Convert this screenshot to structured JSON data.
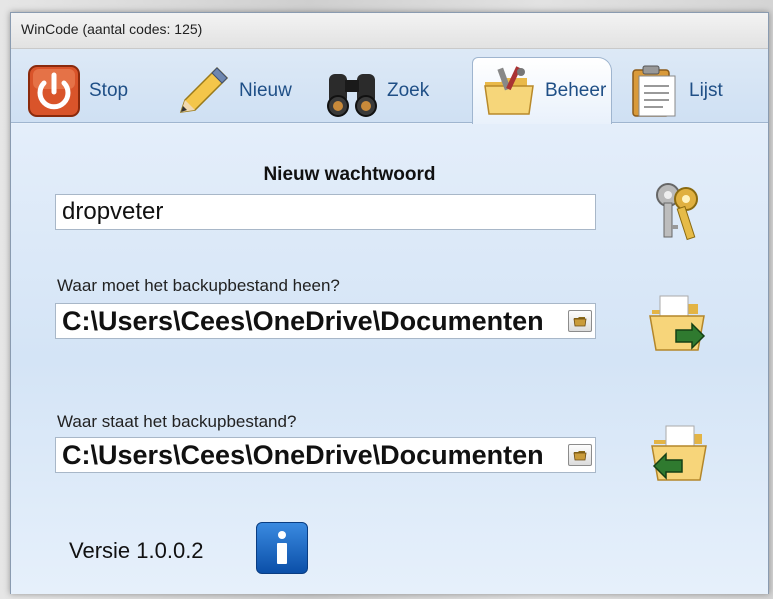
{
  "window": {
    "title": "WinCode (aantal codes: 125)"
  },
  "tabs": [
    {
      "label": "Stop",
      "icon": "power-icon"
    },
    {
      "label": "Nieuw",
      "icon": "pencil-icon"
    },
    {
      "label": "Zoek",
      "icon": "binoculars-icon"
    },
    {
      "label": "Beheer",
      "icon": "folder-tools-icon",
      "active": true
    },
    {
      "label": "Lijst",
      "icon": "clipboard-list-icon"
    }
  ],
  "password": {
    "label": "Nieuw wachtwoord",
    "value": "dropveter"
  },
  "backup_target": {
    "label": "Waar moet het backupbestand heen?",
    "value": "C:\\Users\\Cees\\OneDrive\\Documenten"
  },
  "backup_source": {
    "label": "Waar staat het backupbestand?",
    "value": "C:\\Users\\Cees\\OneDrive\\Documenten"
  },
  "footer": {
    "version": "Versie 1.0.0.2"
  },
  "colors": {
    "tab_text": "#1f4f86",
    "panel_bg": "#dce9f8",
    "info_blue": "#1f6fd0"
  }
}
